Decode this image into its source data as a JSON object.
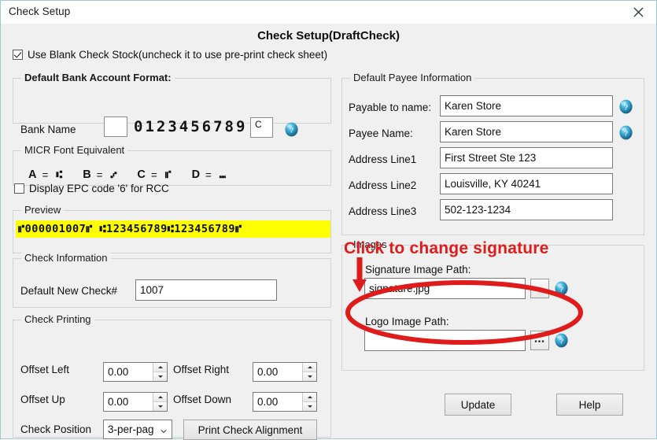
{
  "window": {
    "title": "Check Setup",
    "close_icon": "close-icon",
    "page_title": "Check Setup(DraftCheck)",
    "border_color": "#9fc8d4",
    "background": "#f0f0f0"
  },
  "blank_stock": {
    "checked": true,
    "label": "Use Blank Check Stock(uncheck it to use pre-print check sheet)"
  },
  "bank_format": {
    "legend": "Default Bank Account Format:",
    "bank_name_label": "Bank Name",
    "prefix_value": "",
    "digits": "0123456789",
    "suffix_value": "C",
    "help_icon": "help-icon"
  },
  "micr_equivalent": {
    "legend": "MICR Font Equivalent",
    "pairs": [
      {
        "key": "A",
        "eq": "=",
        "symbol": "⑆"
      },
      {
        "key": "B",
        "eq": "=",
        "symbol": "⑇"
      },
      {
        "key": "C",
        "eq": "=",
        "symbol": "⑈"
      },
      {
        "key": "D",
        "eq": "=",
        "symbol": "⑉"
      }
    ]
  },
  "epc": {
    "checked": false,
    "label": "Display EPC code '6' for RCC"
  },
  "preview": {
    "legend": "Preview",
    "text": "⑈000001007⑈ ⑆123456789⑆123456789⑈",
    "highlight_color": "#ffff00"
  },
  "check_information": {
    "legend": "Check Information",
    "default_check_label": "Default New Check#",
    "default_check_value": "1007"
  },
  "check_printing": {
    "legend": "Check Printing",
    "offset_left_label": "Offset Left",
    "offset_left_value": "0.00",
    "offset_right_label": "Offset Right",
    "offset_right_value": "0.00",
    "offset_up_label": "Offset Up",
    "offset_up_value": "0.00",
    "offset_down_label": "Offset Down",
    "offset_down_value": "0.00",
    "check_position_label": "Check Position",
    "check_position_value": "3-per-pag",
    "print_alignment_label": "Print Check Alignment"
  },
  "payee": {
    "legend": "Default Payee Information",
    "rows": [
      {
        "label": "Payable to name:",
        "value": "Karen Store",
        "help": true
      },
      {
        "label": "Payee Name:",
        "value": "Karen Store",
        "help": true
      },
      {
        "label": "Address Line1",
        "value": "First Street Ste 123",
        "help": false
      },
      {
        "label": "Address Line2",
        "value": "Louisville, KY 40241",
        "help": false
      },
      {
        "label": "Address Line3",
        "value": "502-123-1234",
        "help": false
      }
    ]
  },
  "images": {
    "legend": "Images",
    "signature_label": "Signature Image Path:",
    "signature_value": "signature.jpg",
    "logo_label": "Logo Image Path:",
    "logo_value": "",
    "browse_label": "•••"
  },
  "annotation": {
    "text": "Click to change signature",
    "color": "#e01b1b"
  },
  "footer": {
    "update_label": "Update",
    "help_label": "Help"
  }
}
